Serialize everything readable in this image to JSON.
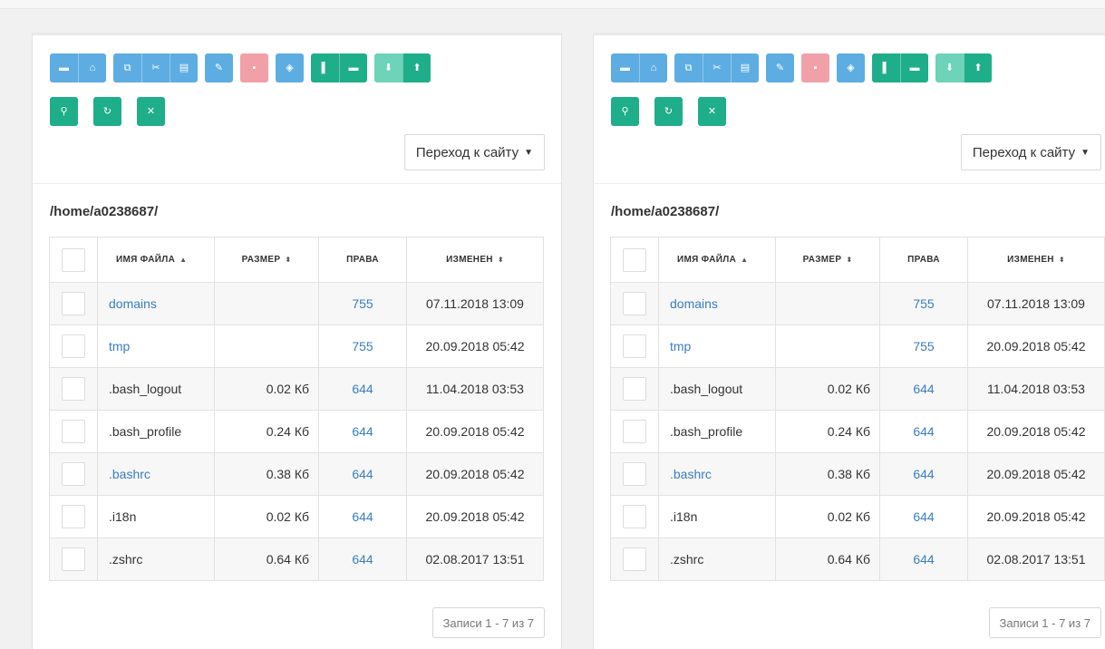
{
  "panels": [
    {
      "toolbar_row1": [
        {
          "buttons": [
            {
              "icon": "hard-drive-icon",
              "glyph": "▬",
              "color": "blue"
            },
            {
              "icon": "hdd-icon",
              "glyph": "⌂",
              "color": "blue"
            }
          ]
        },
        {
          "buttons": [
            {
              "icon": "copy-icon",
              "glyph": "⧉",
              "color": "blue"
            },
            {
              "icon": "scissors-icon",
              "glyph": "✂",
              "color": "blue"
            },
            {
              "icon": "paste-icon",
              "glyph": "▤",
              "color": "blue"
            }
          ]
        },
        {
          "buttons": [
            {
              "icon": "pencil-icon",
              "glyph": "✎",
              "color": "blue"
            }
          ]
        },
        {
          "buttons": [
            {
              "icon": "trash-icon",
              "glyph": "▪",
              "color": "pink"
            }
          ]
        },
        {
          "buttons": [
            {
              "icon": "shield-icon",
              "glyph": "◈",
              "color": "blue"
            }
          ]
        },
        {
          "buttons": [
            {
              "icon": "new-file-icon",
              "glyph": "▌",
              "color": "green"
            },
            {
              "icon": "new-folder-icon",
              "glyph": "▬",
              "color": "green"
            }
          ]
        },
        {
          "buttons": [
            {
              "icon": "download-icon",
              "glyph": "⬇",
              "color": "green-light"
            },
            {
              "icon": "upload-icon",
              "glyph": "⬆",
              "color": "green"
            }
          ]
        }
      ],
      "toolbar_row2": [
        {
          "icon": "search-icon",
          "glyph": "⚲"
        },
        {
          "icon": "refresh-icon",
          "glyph": "↻"
        },
        {
          "icon": "fullscreen-icon",
          "glyph": "✕"
        }
      ],
      "site_dropdown": "Переход к сайту",
      "path": "/home/a0238687/",
      "headers": {
        "name": "ИМЯ ФАЙЛА",
        "size": "РАЗМЕР",
        "perm": "ПРАВА",
        "modified": "ИЗМЕНЕН"
      },
      "rows": [
        {
          "name": "domains",
          "size": "",
          "perm": "755",
          "modified": "07.11.2018 13:09",
          "is_link": true
        },
        {
          "name": "tmp",
          "size": "",
          "perm": "755",
          "modified": "20.09.2018 05:42",
          "is_link": true
        },
        {
          "name": ".bash_logout",
          "size": "0.02 Кб",
          "perm": "644",
          "modified": "11.04.2018 03:53",
          "is_link": false
        },
        {
          "name": ".bash_profile",
          "size": "0.24 Кб",
          "perm": "644",
          "modified": "20.09.2018 05:42",
          "is_link": false
        },
        {
          "name": ".bashrc",
          "size": "0.38 Кб",
          "perm": "644",
          "modified": "20.09.2018 05:42",
          "is_link": true
        },
        {
          "name": ".i18n",
          "size": "0.02 Кб",
          "perm": "644",
          "modified": "20.09.2018 05:42",
          "is_link": false
        },
        {
          "name": ".zshrc",
          "size": "0.64 Кб",
          "perm": "644",
          "modified": "02.08.2017 13:51",
          "is_link": false
        }
      ],
      "pager": "Записи 1 - 7 из 7"
    },
    {
      "toolbar_row1": [
        {
          "buttons": [
            {
              "icon": "hard-drive-icon",
              "glyph": "▬",
              "color": "blue"
            },
            {
              "icon": "hdd-icon",
              "glyph": "⌂",
              "color": "blue"
            }
          ]
        },
        {
          "buttons": [
            {
              "icon": "copy-icon",
              "glyph": "⧉",
              "color": "blue"
            },
            {
              "icon": "scissors-icon",
              "glyph": "✂",
              "color": "blue"
            },
            {
              "icon": "paste-icon",
              "glyph": "▤",
              "color": "blue"
            }
          ]
        },
        {
          "buttons": [
            {
              "icon": "pencil-icon",
              "glyph": "✎",
              "color": "blue"
            }
          ]
        },
        {
          "buttons": [
            {
              "icon": "trash-icon",
              "glyph": "▪",
              "color": "pink"
            }
          ]
        },
        {
          "buttons": [
            {
              "icon": "shield-icon",
              "glyph": "◈",
              "color": "blue"
            }
          ]
        },
        {
          "buttons": [
            {
              "icon": "new-file-icon",
              "glyph": "▌",
              "color": "green"
            },
            {
              "icon": "new-folder-icon",
              "glyph": "▬",
              "color": "green"
            }
          ]
        },
        {
          "buttons": [
            {
              "icon": "download-icon",
              "glyph": "⬇",
              "color": "green-light"
            },
            {
              "icon": "upload-icon",
              "glyph": "⬆",
              "color": "green"
            }
          ]
        }
      ],
      "toolbar_row2": [
        {
          "icon": "search-icon",
          "glyph": "⚲"
        },
        {
          "icon": "refresh-icon",
          "glyph": "↻"
        },
        {
          "icon": "fullscreen-icon",
          "glyph": "✕"
        }
      ],
      "site_dropdown": "Переход к сайту",
      "path": "/home/a0238687/",
      "headers": {
        "name": "ИМЯ ФАЙЛА",
        "size": "РАЗМЕР",
        "perm": "ПРАВА",
        "modified": "ИЗМЕНЕН"
      },
      "rows": [
        {
          "name": "domains",
          "size": "",
          "perm": "755",
          "modified": "07.11.2018 13:09",
          "is_link": true
        },
        {
          "name": "tmp",
          "size": "",
          "perm": "755",
          "modified": "20.09.2018 05:42",
          "is_link": true
        },
        {
          "name": ".bash_logout",
          "size": "0.02 Кб",
          "perm": "644",
          "modified": "11.04.2018 03:53",
          "is_link": false
        },
        {
          "name": ".bash_profile",
          "size": "0.24 Кб",
          "perm": "644",
          "modified": "20.09.2018 05:42",
          "is_link": false
        },
        {
          "name": ".bashrc",
          "size": "0.38 Кб",
          "perm": "644",
          "modified": "20.09.2018 05:42",
          "is_link": true
        },
        {
          "name": ".i18n",
          "size": "0.02 Кб",
          "perm": "644",
          "modified": "20.09.2018 05:42",
          "is_link": false
        },
        {
          "name": ".zshrc",
          "size": "0.64 Кб",
          "perm": "644",
          "modified": "02.08.2017 13:51",
          "is_link": false
        }
      ],
      "pager": "Записи 1 - 7 из 7"
    }
  ],
  "colors": {
    "blue": "#5dade2",
    "pink": "#f1a0a8",
    "green": "#1fae8a",
    "green-light": "#6dd3b9",
    "link": "#3a7ebf"
  }
}
